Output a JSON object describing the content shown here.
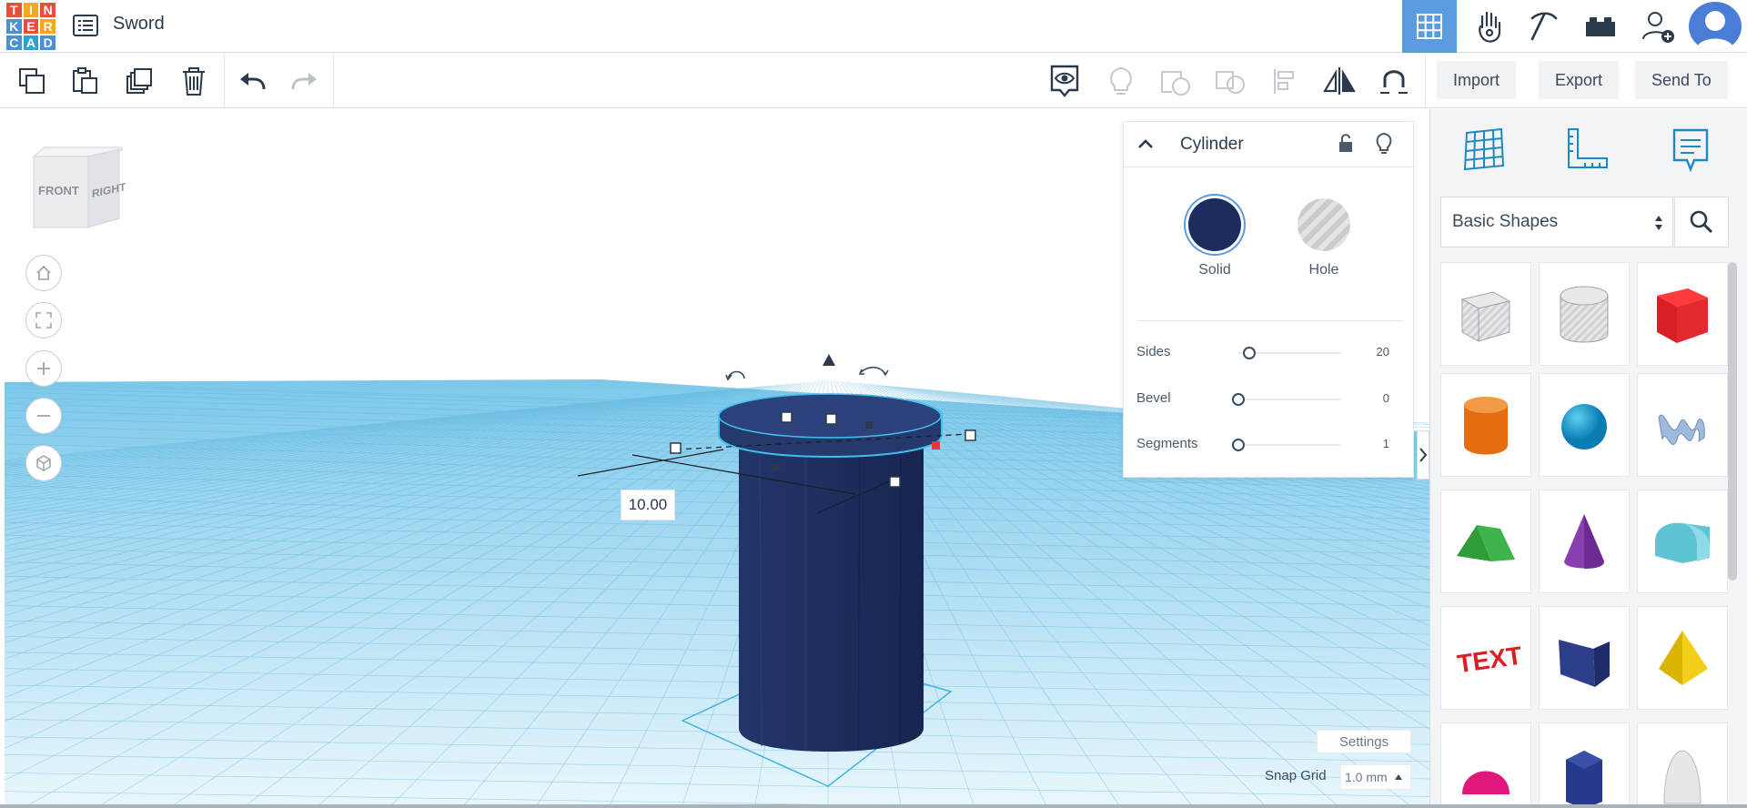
{
  "app": {
    "logo_letters": [
      "T",
      "I",
      "N",
      "K",
      "E",
      "R",
      "C",
      "A",
      "D"
    ],
    "design_title": "Sword"
  },
  "toolbar": {
    "import_label": "Import",
    "export_label": "Export",
    "send_to_label": "Send To"
  },
  "workplane": {
    "viewcube": {
      "front_label": "FRONT",
      "right_label": "RIGHT"
    },
    "dimension_value": "10.00",
    "settings_label": "Settings",
    "snap_grid_label": "Snap Grid",
    "snap_grid_value": "1.0 mm"
  },
  "inspector": {
    "title": "Cylinder",
    "solid_label": "Solid",
    "hole_label": "Hole",
    "solid_color": "#1b2d5c",
    "params": [
      {
        "label": "Sides",
        "value": "20",
        "level": 0.11
      },
      {
        "label": "Bevel",
        "value": "0",
        "level": 0
      },
      {
        "label": "Segments",
        "value": "1",
        "level": 0
      }
    ]
  },
  "shapes_panel": {
    "category": "Basic Shapes",
    "shapes": [
      "box-hole-icon",
      "cylinder-hole-icon",
      "box-icon",
      "cylinder-icon",
      "sphere-icon",
      "scribble-icon",
      "roof-icon",
      "cone-icon",
      "round-roof-icon",
      "text-icon",
      "wedge-icon",
      "pyramid-icon",
      "half-sphere-icon",
      "polygon-icon",
      "paraboloid-icon"
    ]
  },
  "colors": {
    "accent": "#5b9be0",
    "grid": "#8fd0ee",
    "workplane_bg": "#dff3fb",
    "shape": "#1b2d5c"
  }
}
